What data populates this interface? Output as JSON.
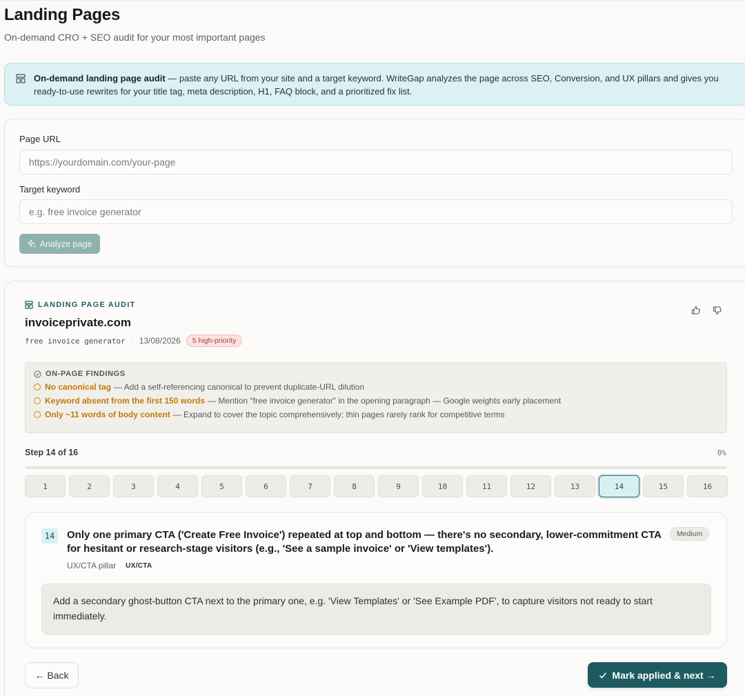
{
  "header": {
    "title": "Landing Pages",
    "subtitle": "On-demand CRO + SEO audit for your most important pages"
  },
  "banner": {
    "icon": "layout-icon",
    "bold": "On-demand landing page audit",
    "text": " — paste any URL from your site and a target keyword. WriteGap analyzes the page across SEO, Conversion, and UX pillars and gives you ready-to-use rewrites for your title tag, meta description, H1, FAQ block, and a prioritized fix list."
  },
  "form": {
    "url_label": "Page URL",
    "url_placeholder": "https://yourdomain.com/your-page",
    "keyword_label": "Target keyword",
    "keyword_placeholder": "e.g. free invoice generator",
    "analyze_label": "Analyze page"
  },
  "audit": {
    "eyebrow": "LANDING PAGE AUDIT",
    "domain": "invoiceprivate.com",
    "keyword": "free invoice generator",
    "separator": "·",
    "date": "13/08/2026",
    "priority_badge": "5 high-priority",
    "findings": {
      "title": "ON-PAGE FINDINGS",
      "items": [
        {
          "highlight": "No canonical tag",
          "text": " — Add a self-referencing canonical to prevent duplicate-URL dilution"
        },
        {
          "highlight": "Keyword absent from the first 150 words",
          "text": " — Mention \"free invoice generator\" in the opening paragraph — Google weights early placement"
        },
        {
          "highlight": "Only ~11 words of body content",
          "text": " — Expand to cover the topic comprehensively; thin pages rarely rank for competitive terms"
        }
      ]
    },
    "progress": {
      "label": "Step 14 of 16",
      "percent_text": "0%",
      "percent": 0,
      "current": 14,
      "steps": [
        "1",
        "2",
        "3",
        "4",
        "5",
        "6",
        "7",
        "8",
        "9",
        "10",
        "11",
        "12",
        "13",
        "14",
        "15",
        "16"
      ]
    },
    "issue": {
      "number": "14",
      "title": "Only one primary CTA ('Create Free Invoice') repeated at top and bottom — there's no secondary, lower-commitment CTA for hesitant or research-stage visitors (e.g., 'See a sample invoice' or 'View templates').",
      "severity": "Medium",
      "pillar": "UX/CTA pillar",
      "pillar_tag": "UX/CTA",
      "fix": "Add a secondary ghost-button CTA next to the primary one, e.g. 'View Templates' or 'See Example PDF', to capture visitors not ready to start immediately."
    },
    "back_label": "← Back",
    "next_label": "Mark applied & next →"
  },
  "colors": {
    "accent": "#1d5b60",
    "banner_bg": "#dbf1f4",
    "finding_highlight": "#c07a0b",
    "priority_red": "#b23a33"
  }
}
